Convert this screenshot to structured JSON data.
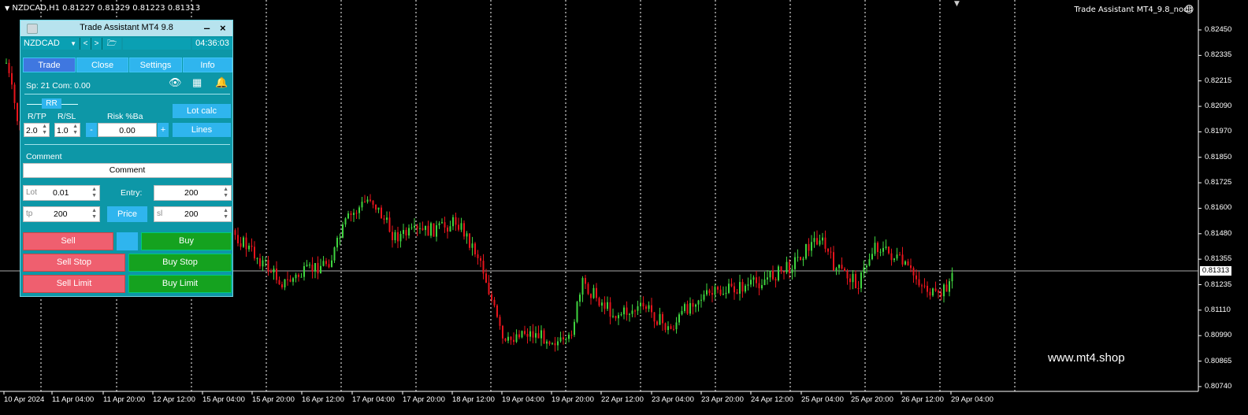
{
  "chart": {
    "symbol_header": "NZDCAD,H1  0.81227 0.81329 0.81223 0.81313",
    "ea_label": "Trade Assistant MT4_9.8_nodll",
    "watermark": "www.mt4.shop",
    "current_price": "0.81313",
    "price_ticks": [
      "0.82450",
      "0.82335",
      "0.82215",
      "0.82090",
      "0.81970",
      "0.81850",
      "0.81725",
      "0.81600",
      "0.81480",
      "0.81355",
      "0.81235",
      "0.81110",
      "0.80990",
      "0.80865",
      "0.80740"
    ],
    "time_ticks": [
      "10 Apr 2024",
      "11 Apr 04:00",
      "11 Apr 20:00",
      "12 Apr 12:00",
      "15 Apr 04:00",
      "15 Apr 20:00",
      "16 Apr 12:00",
      "17 Apr 04:00",
      "17 Apr 20:00",
      "18 Apr 12:00",
      "19 Apr 04:00",
      "19 Apr 20:00",
      "22 Apr 12:00",
      "23 Apr 04:00",
      "23 Apr 20:00",
      "24 Apr 12:00",
      "25 Apr 04:00",
      "25 Apr 20:00",
      "26 Apr 12:00",
      "29 Apr 04:00"
    ],
    "colors": {
      "bull": "#3fd43f",
      "bear": "#e8141c",
      "background": "#000000",
      "grid": "#ffffff"
    }
  },
  "panel": {
    "title": "Trade Assistant MT4 9.8",
    "minimize": "‒",
    "close": "×",
    "symbol": "NZDCAD",
    "nav_prev": "<",
    "nav_next": ">",
    "timer": "04:36:03",
    "tabs": [
      "Trade",
      "Close",
      "Settings",
      "Info"
    ],
    "spread_info": "Sp: 21  Com: 0.00",
    "rr_label": "RR",
    "rtp_label": "R/TP",
    "rsl_label": "R/SL",
    "risk_label": "Risk %Ba",
    "rtp_value": "2.0",
    "rsl_value": "1.0",
    "risk_minus": "-",
    "risk_value": "0.00",
    "risk_plus": "+",
    "lotcalc_label": "Lot calc",
    "lines_label": "Lines",
    "comment_label": "Comment",
    "comment_value": "Comment",
    "lot_placeholder": "Lot",
    "lot_value": "0.01",
    "entry_label": "Entry:",
    "entry_value": "200",
    "tp_placeholder": "tp",
    "tp_value": "200",
    "price_label": "Price",
    "sl_placeholder": "sl",
    "sl_value": "200",
    "sell_label": "Sell",
    "buy_label": "Buy",
    "sellstop_label": "Sell Stop",
    "buystop_label": "Buy Stop",
    "selllimit_label": "Sell Limit",
    "buylimit_label": "Buy Limit"
  }
}
